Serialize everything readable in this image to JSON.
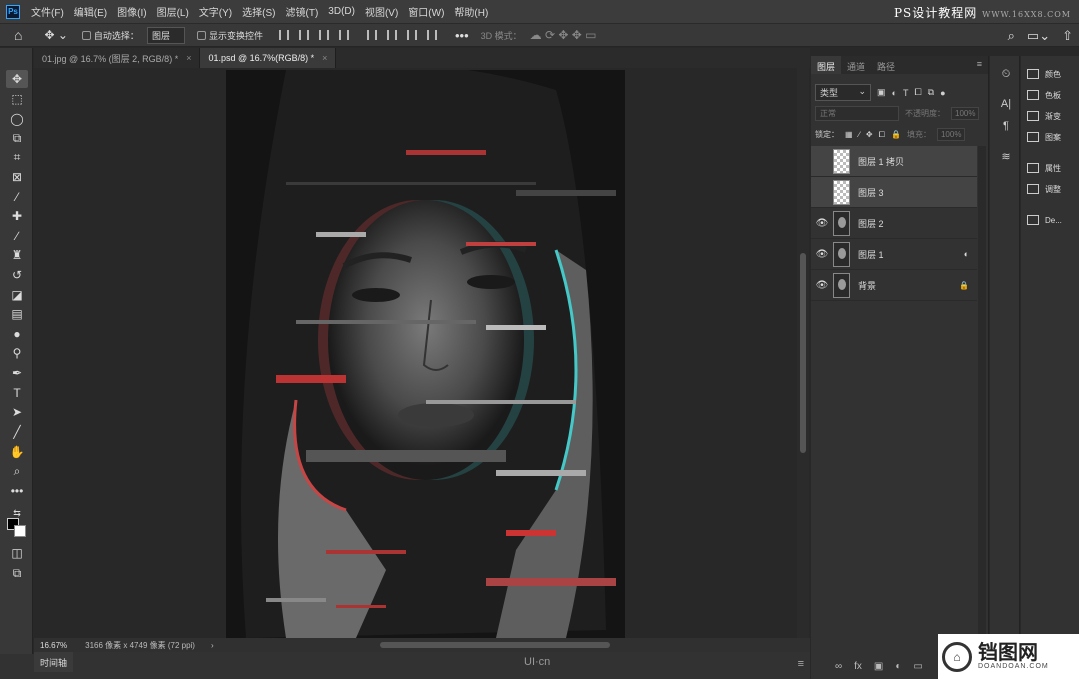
{
  "menubar": {
    "logo": "Ps",
    "items": [
      "文件(F)",
      "编辑(E)",
      "图像(I)",
      "图层(L)",
      "文字(Y)",
      "选择(S)",
      "滤镜(T)",
      "3D(D)",
      "视图(V)",
      "窗口(W)",
      "帮助(H)"
    ],
    "watermark": "PS设计教程网",
    "watermark_url": "WWW.16XX8.COM"
  },
  "options": {
    "auto_select_label": "自动选择：",
    "auto_select_value": "图层",
    "show_transform_label": "显示变换控件",
    "mode_3d": "3D 模式："
  },
  "tabs": [
    {
      "label": "01.jpg @ 16.7% (图层 2, RGB/8) *",
      "close": "×"
    },
    {
      "label": "01.psd @ 16.7%(RGB/8) *",
      "close": "×"
    }
  ],
  "status": {
    "zoom": "16.67%",
    "info": "3166 像素 x 4749 像素 (72 ppi)",
    "arrow": "›"
  },
  "bottom": {
    "timeline": "时间轴",
    "brand": "UI·cn"
  },
  "layers_panel": {
    "tabs": [
      "图层",
      "通道",
      "路径"
    ],
    "filter_kind": "类型",
    "blend_mode": "正常",
    "opacity_label": "不透明度：",
    "opacity_value": "100%",
    "lock_label": "锁定：",
    "fill_label": "填充：",
    "fill_value": "100%",
    "layers": [
      {
        "name": "图层 1 拷贝",
        "visible": false,
        "thumb": "check",
        "badge": ""
      },
      {
        "name": "图层 3",
        "visible": false,
        "thumb": "check",
        "badge": ""
      },
      {
        "name": "图层 2",
        "visible": true,
        "thumb": "face",
        "badge": ""
      },
      {
        "name": "图层 1",
        "visible": true,
        "thumb": "face",
        "badge": "◐"
      },
      {
        "name": "背景",
        "visible": true,
        "thumb": "face",
        "badge": "🔒"
      }
    ],
    "footer_icons": [
      "∞",
      "fx",
      "▣",
      "◐",
      "▭",
      "+",
      "🗑"
    ]
  },
  "right_panel": {
    "items": [
      "颜色",
      "色板",
      "渐变",
      "图案",
      "属性",
      "调整",
      "De..."
    ]
  },
  "logo_watermark": {
    "text": "铛图网",
    "sub": "DOANDOAN.COM"
  }
}
